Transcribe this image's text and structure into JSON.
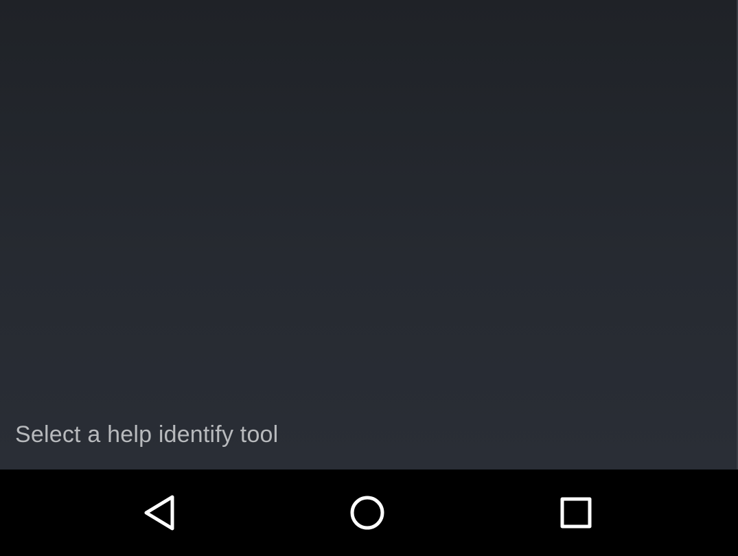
{
  "content": {
    "hint_text": "Select a help identify tool"
  },
  "navbar": {
    "back_icon": "back-triangle-icon",
    "home_icon": "home-circle-icon",
    "recents_icon": "recents-square-icon",
    "icon_color": "#ffffff",
    "background_color": "#000000"
  }
}
